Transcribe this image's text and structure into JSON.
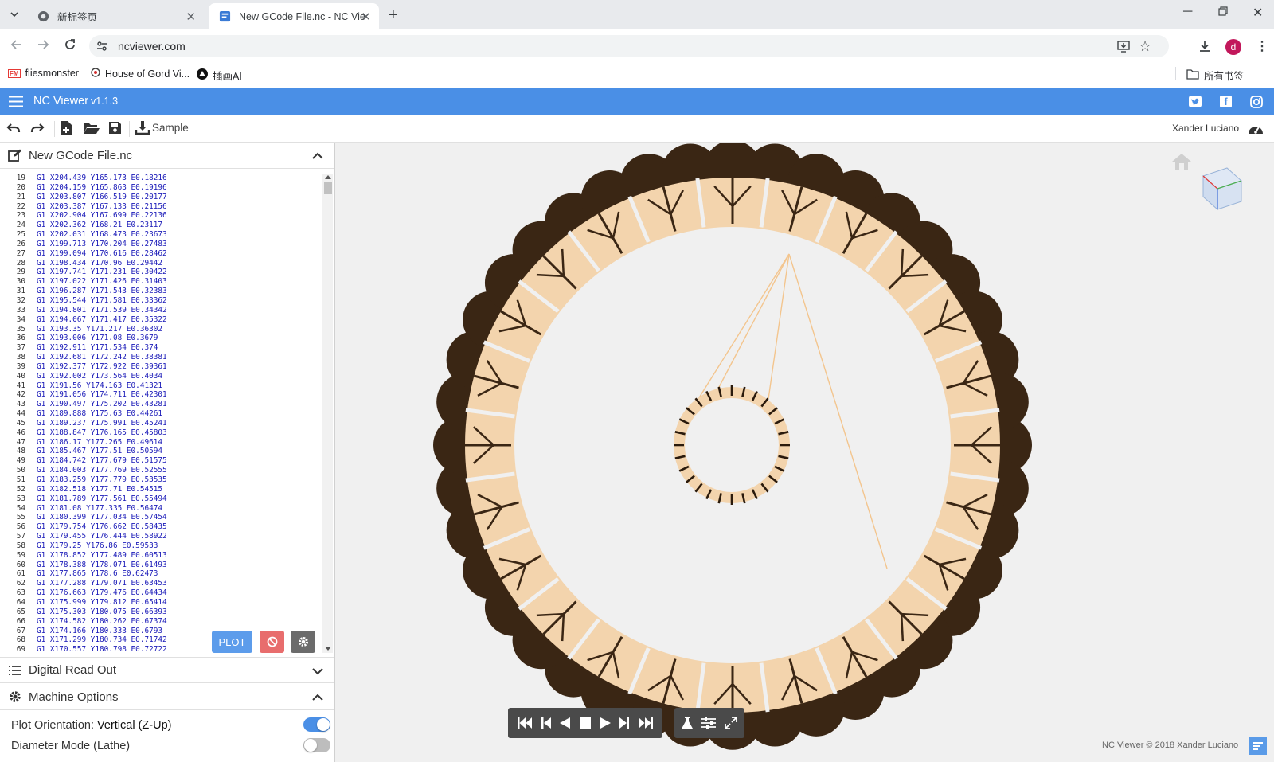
{
  "browser": {
    "tabs": [
      {
        "title": "新标签页"
      },
      {
        "title": "New GCode File.nc - NC Viewer"
      }
    ],
    "url": "ncviewer.com",
    "profile_initial": "d",
    "bookmarks": [
      {
        "label": "fliesmonster"
      },
      {
        "label": "House of Gord Vi..."
      },
      {
        "label": "插画AI"
      }
    ],
    "all_bookmarks": "所有书签"
  },
  "app": {
    "name": "NC Viewer",
    "version": "v1.1.3",
    "toolbar": {
      "sample_label": "Sample",
      "author": "Xander Luciano"
    },
    "file_panel": {
      "title": "New GCode File.nc",
      "plot_label": "PLOT",
      "lines": [
        {
          "n": "19",
          "code": "G1 X204.439 Y165.173 E0.18216"
        },
        {
          "n": "20",
          "code": "G1 X204.159 Y165.863 E0.19196"
        },
        {
          "n": "21",
          "code": "G1 X203.807 Y166.519 E0.20177"
        },
        {
          "n": "22",
          "code": "G1 X203.387 Y167.133 E0.21156"
        },
        {
          "n": "23",
          "code": "G1 X202.904 Y167.699 E0.22136"
        },
        {
          "n": "24",
          "code": "G1 X202.362 Y168.21 E0.23117"
        },
        {
          "n": "25",
          "code": "G1 X202.031 Y168.473 E0.23673"
        },
        {
          "n": "26",
          "code": "G1 X199.713 Y170.204 E0.27483"
        },
        {
          "n": "27",
          "code": "G1 X199.094 Y170.616 E0.28462"
        },
        {
          "n": "28",
          "code": "G1 X198.434 Y170.96 E0.29442"
        },
        {
          "n": "29",
          "code": "G1 X197.741 Y171.231 E0.30422"
        },
        {
          "n": "30",
          "code": "G1 X197.022 Y171.426 E0.31403"
        },
        {
          "n": "31",
          "code": "G1 X196.287 Y171.543 E0.32383"
        },
        {
          "n": "32",
          "code": "G1 X195.544 Y171.581 E0.33362"
        },
        {
          "n": "33",
          "code": "G1 X194.801 Y171.539 E0.34342"
        },
        {
          "n": "34",
          "code": "G1 X194.067 Y171.417 E0.35322"
        },
        {
          "n": "35",
          "code": "G1 X193.35 Y171.217 E0.36302"
        },
        {
          "n": "36",
          "code": "G1 X193.006 Y171.08 E0.3679"
        },
        {
          "n": "37",
          "code": "G1 X192.911 Y171.534 E0.374"
        },
        {
          "n": "38",
          "code": "G1 X192.681 Y172.242 E0.38381"
        },
        {
          "n": "39",
          "code": "G1 X192.377 Y172.922 E0.39361"
        },
        {
          "n": "40",
          "code": "G1 X192.002 Y173.564 E0.4034"
        },
        {
          "n": "41",
          "code": "G1 X191.56 Y174.163 E0.41321"
        },
        {
          "n": "42",
          "code": "G1 X191.056 Y174.711 E0.42301"
        },
        {
          "n": "43",
          "code": "G1 X190.497 Y175.202 E0.43281"
        },
        {
          "n": "44",
          "code": "G1 X189.888 Y175.63 E0.44261"
        },
        {
          "n": "45",
          "code": "G1 X189.237 Y175.991 E0.45241"
        },
        {
          "n": "46",
          "code": "G1 X188.847 Y176.165 E0.45803"
        },
        {
          "n": "47",
          "code": "G1 X186.17 Y177.265 E0.49614"
        },
        {
          "n": "48",
          "code": "G1 X185.467 Y177.51 E0.50594"
        },
        {
          "n": "49",
          "code": "G1 X184.742 Y177.679 E0.51575"
        },
        {
          "n": "50",
          "code": "G1 X184.003 Y177.769 E0.52555"
        },
        {
          "n": "51",
          "code": "G1 X183.259 Y177.779 E0.53535"
        },
        {
          "n": "52",
          "code": "G1 X182.518 Y177.71 E0.54515"
        },
        {
          "n": "53",
          "code": "G1 X181.789 Y177.561 E0.55494"
        },
        {
          "n": "54",
          "code": "G1 X181.08 Y177.335 E0.56474"
        },
        {
          "n": "55",
          "code": "G1 X180.399 Y177.034 E0.57454"
        },
        {
          "n": "56",
          "code": "G1 X179.754 Y176.662 E0.58435"
        },
        {
          "n": "57",
          "code": "G1 X179.455 Y176.444 E0.58922"
        },
        {
          "n": "58",
          "code": "G1 X179.25 Y176.86 E0.59533"
        },
        {
          "n": "59",
          "code": "G1 X178.852 Y177.489 E0.60513"
        },
        {
          "n": "60",
          "code": "G1 X178.388 Y178.071 E0.61493"
        },
        {
          "n": "61",
          "code": "G1 X177.865 Y178.6 E0.62473"
        },
        {
          "n": "62",
          "code": "G1 X177.288 Y179.071 E0.63453"
        },
        {
          "n": "63",
          "code": "G1 X176.663 Y179.476 E0.64434"
        },
        {
          "n": "64",
          "code": "G1 X175.999 Y179.812 E0.65414"
        },
        {
          "n": "65",
          "code": "G1 X175.303 Y180.075 E0.66393"
        },
        {
          "n": "66",
          "code": "G1 X174.582 Y180.262 E0.67374"
        },
        {
          "n": "67",
          "code": "G1 X174.166 Y180.333 E0.6793"
        },
        {
          "n": "68",
          "code": "G1 X171.299 Y180.734 E0.71742"
        },
        {
          "n": "69",
          "code": "G1 X170.557 Y180.798 E0.72722"
        }
      ]
    },
    "dro_panel": {
      "title": "Digital Read Out"
    },
    "machine_panel": {
      "title": "Machine Options",
      "plot_orientation_label": "Plot Orientation:",
      "plot_orientation_value": "Vertical (Z-Up)",
      "plot_orientation_on": true,
      "diameter_mode_label": "Diameter Mode (Lathe)",
      "diameter_mode_on": false
    },
    "footer_credit": "NC Viewer © 2018 Xander Luciano"
  }
}
